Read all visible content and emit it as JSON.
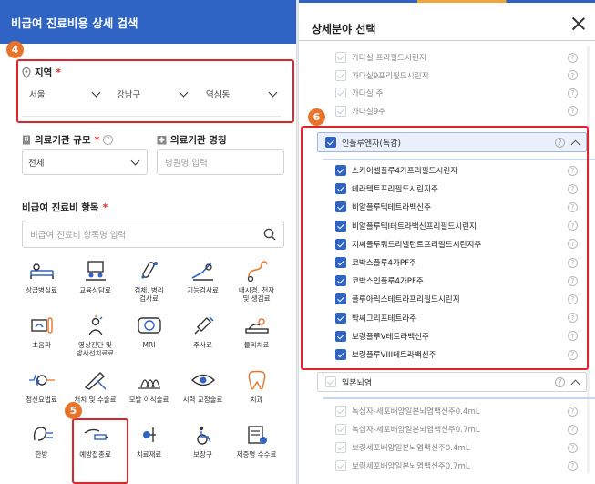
{
  "left": {
    "title": "비급여 진료비용 상세 검색",
    "badge_region": "4",
    "badge_treatment": "5",
    "region": {
      "label": "지역",
      "required": "*",
      "city": "서울",
      "district": "강남구",
      "dong": "역삼동"
    },
    "scale": {
      "label": "의료기관 규모",
      "required": "*",
      "help": "?",
      "value": "전체"
    },
    "name": {
      "label": "의료기관 명칭",
      "placeholder": "병원명 입력"
    },
    "items": {
      "label": "비급여 진료비 항목",
      "required": "*",
      "placeholder": "비급여 진료비 항목명 입력"
    },
    "categories": [
      {
        "label": "상급병실료",
        "icon": "bed-icon"
      },
      {
        "label": "교육상담료",
        "icon": "consult-icon"
      },
      {
        "label": "검체, 병리\n검사료",
        "icon": "test-tube-icon"
      },
      {
        "label": "기능검사료",
        "icon": "function-test-icon"
      },
      {
        "label": "내시경, 천자\n및 생검료",
        "icon": "endoscope-icon"
      },
      {
        "label": "초음파",
        "icon": "ultrasound-icon"
      },
      {
        "label": "영상진단 및\n방사선치료료",
        "icon": "radiology-icon"
      },
      {
        "label": "MRI",
        "icon": "mri-icon"
      },
      {
        "label": "주사료",
        "icon": "syringe-icon"
      },
      {
        "label": "물리치료",
        "icon": "physio-icon"
      },
      {
        "label": "정신요법료",
        "icon": "brain-wave-icon"
      },
      {
        "label": "처치 및 수술료",
        "icon": "surgery-icon"
      },
      {
        "label": "모발 이식술료",
        "icon": "hair-icon"
      },
      {
        "label": "시력 교정술료",
        "icon": "eye-icon"
      },
      {
        "label": "치과",
        "icon": "tooth-icon"
      },
      {
        "label": "한방",
        "icon": "oriental-icon"
      },
      {
        "label": "예방접종료",
        "icon": "vaccine-icon"
      },
      {
        "label": "치료재료",
        "icon": "material-icon"
      },
      {
        "label": "보장구",
        "icon": "wheelchair-icon"
      },
      {
        "label": "제증명 수수료",
        "icon": "certificate-icon"
      }
    ]
  },
  "right": {
    "title": "상세분야 선택",
    "badge": "6",
    "top_items": [
      "가다실 프리필드시린지",
      "가다실9프리필드시린지",
      "가다실 주",
      "가다실9주"
    ],
    "group_flu": "인플루엔자(독감)",
    "flu_items": [
      "스카이셀플루4가프리필드시린지",
      "테라텍트프리필드시린지주",
      "비알플루텍테트라백신주",
      "비알플루텍I테트라백신프리필드시린지",
      "지씨플루쿼드리밸런트프리필드시린지주",
      "코박스플루4가PF주",
      "코박스인플루4가PF주",
      "플루아릭스테트라프리필드시린지",
      "박씨그리프테트라주",
      "보령플루V테트라백신주",
      "보령플루VIII테트라백신주"
    ],
    "group_je": "일본뇌염",
    "je_items": [
      "녹십자-세포배양일본뇌염백신주0.4mL",
      "녹십자-세포배양일본뇌염백신주0.7mL",
      "보령세포배양일본뇌염백신주0.4mL",
      "보령세포배양일본뇌염백신주0.7mL"
    ]
  },
  "colors": {
    "brand_blue": "#2f63c4",
    "highlight_red": "#e0242a",
    "badge_orange": "#e8742c"
  }
}
